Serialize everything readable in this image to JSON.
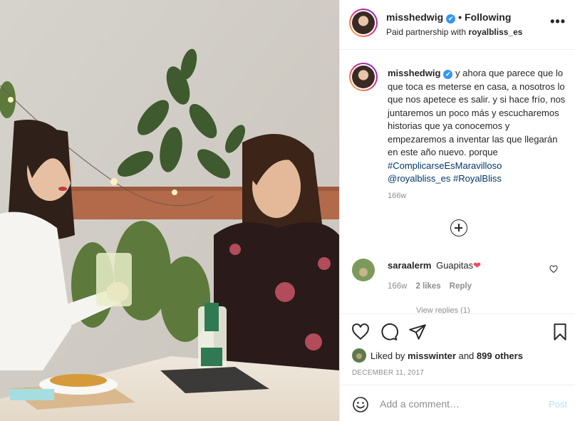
{
  "header": {
    "username": "misshedwig",
    "verified_icon": "✔",
    "separator": "•",
    "follow_status": "Following",
    "partnership_prefix": "Paid partnership with",
    "partner": "royalbliss_es",
    "more_icon": "•••"
  },
  "caption": {
    "username": "misshedwig",
    "text": "y ahora que parece que lo que toca es meterse en casa, a nosotros lo que nos apetece es salir. y si hace frío, nos juntaremos un poco más y escucharemos historias que ya conocemos y empezaremos a inventar las que llegarán en este año nuevo. porque",
    "hashtag1": "#ComplicarseEsMaravilloso",
    "mention": "@royalbliss_es",
    "hashtag2": "#RoyalBliss",
    "time": "166w"
  },
  "comment": {
    "username": "saraalerm",
    "text": "Guapitas",
    "emoji": "❤",
    "time": "166w",
    "likes": "2 likes",
    "reply_label": "Reply",
    "view_replies": "View replies (1)"
  },
  "likes": {
    "prefix": "Liked by",
    "user": "misswinter",
    "and": "and",
    "others": "899 others"
  },
  "post_date": "DECEMBER 11, 2017",
  "add_comment": {
    "placeholder": "Add a comment…",
    "post_label": "Post"
  },
  "colors": {
    "link": "#00376b",
    "verified": "#3897f0",
    "muted": "#8e8e8e",
    "post_disabled": "#b2dffc"
  }
}
